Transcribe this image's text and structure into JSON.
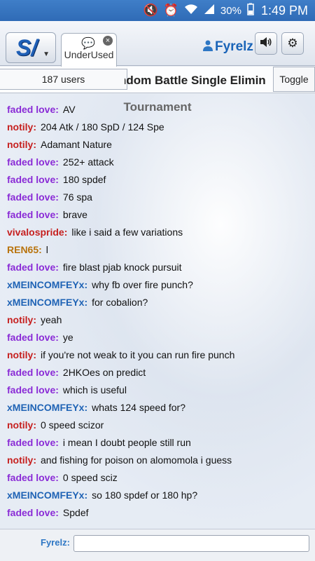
{
  "status_bar": {
    "battery_pct": "30%",
    "time": "1:49 PM",
    "icons": [
      "mute-icon",
      "alarm-icon",
      "wifi-icon",
      "signal-icon",
      "battery-icon"
    ]
  },
  "header": {
    "tab_label": "UnderUsed",
    "username": "Fyrelz"
  },
  "room": {
    "users_label": "187 users",
    "title": "ndom Battle Single Elimin",
    "toggle_label": "Toggle",
    "subtitle": "Tournament"
  },
  "colors": {
    "faded love": "#8a2bd6",
    "notily": "#c6201f",
    "vivalospride": "#c6201f",
    "REN65": "#b8730c",
    "xMEINCOMFEYx": "#1f63b5"
  },
  "messages": [
    {
      "user": "faded love:",
      "text": "AV",
      "color": "#8a2bd6"
    },
    {
      "user": "notily:",
      "text": "204 Atk / 180 SpD / 124 Spe",
      "color": "#c6201f"
    },
    {
      "user": "notily:",
      "text": "Adamant Nature",
      "color": "#c6201f"
    },
    {
      "user": "faded love:",
      "text": "252+ attack",
      "color": "#8a2bd6"
    },
    {
      "user": "faded love:",
      "text": "180 spdef",
      "color": "#8a2bd6"
    },
    {
      "user": "faded love:",
      "text": "76 spa",
      "color": "#8a2bd6"
    },
    {
      "user": "faded love:",
      "text": "brave",
      "color": "#8a2bd6"
    },
    {
      "user": "vivalospride:",
      "text": "like i said a few variations",
      "color": "#c6201f"
    },
    {
      "user": "REN65:",
      "text": "l",
      "color": "#b8730c"
    },
    {
      "user": "faded love:",
      "text": "fire blast pjab knock pursuit",
      "color": "#8a2bd6"
    },
    {
      "user": "xMEINCOMFEYx:",
      "text": "why fb over fire punch?",
      "color": "#1f63b5"
    },
    {
      "user": "xMEINCOMFEYx:",
      "text": "for cobalion?",
      "color": "#1f63b5"
    },
    {
      "user": "notily:",
      "text": "yeah",
      "color": "#c6201f"
    },
    {
      "user": "faded love:",
      "text": "ye",
      "color": "#8a2bd6"
    },
    {
      "user": "notily:",
      "text": "if you're not weak to it you can run fire punch",
      "color": "#c6201f"
    },
    {
      "user": "faded love:",
      "text": "2HKOes on predict",
      "color": "#8a2bd6"
    },
    {
      "user": "faded love:",
      "text": "which is useful",
      "color": "#8a2bd6"
    },
    {
      "user": "xMEINCOMFEYx:",
      "text": "whats 124 speed for?",
      "color": "#1f63b5"
    },
    {
      "user": "notily:",
      "text": "0 speed scizor",
      "color": "#c6201f"
    },
    {
      "user": "faded love:",
      "text": "i mean I doubt people still run",
      "color": "#8a2bd6"
    },
    {
      "user": "notily:",
      "text": "and fishing for poison on alomomola i guess",
      "color": "#c6201f"
    },
    {
      "user": "faded love:",
      "text": "0 speed sciz",
      "color": "#8a2bd6"
    },
    {
      "user": "xMEINCOMFEYx:",
      "text": "so 180 spdef or 180 hp?",
      "color": "#1f63b5"
    },
    {
      "user": "faded love:",
      "text": "Spdef",
      "color": "#8a2bd6"
    }
  ],
  "footer": {
    "me_label": "Fyrelz:",
    "input_value": ""
  }
}
